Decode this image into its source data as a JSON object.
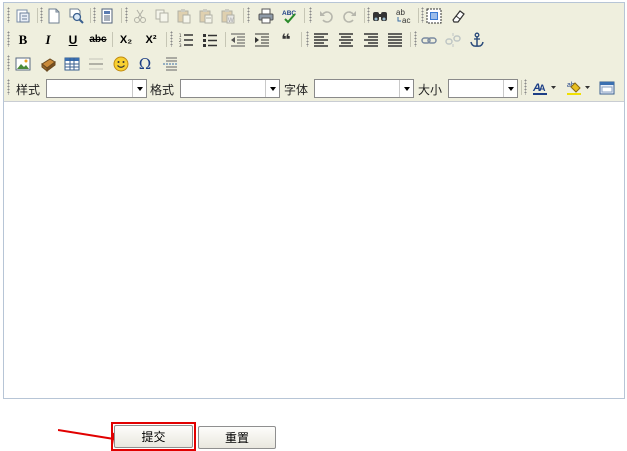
{
  "toolbar": {
    "style_label": "样式",
    "format_label": "格式",
    "font_label": "字体",
    "size_label": "大小",
    "bold_glyph": "B",
    "italic_glyph": "I",
    "underline_glyph": "U",
    "strike_glyph": "abc",
    "subscript_glyph": "X₂",
    "superscript_glyph": "X²",
    "omega_glyph": "Ω",
    "abc_spell_glyph": "ABC",
    "replace_glyph_top": "ab",
    "replace_glyph_bottom": "ac",
    "quote_glyph": "❝"
  },
  "form": {
    "submit_label": "提交",
    "reset_label": "重置"
  },
  "colors": {
    "toolbar_bg": "#efefde",
    "highlight_red": "#e10000",
    "editor_border": "#b7c5d6"
  }
}
